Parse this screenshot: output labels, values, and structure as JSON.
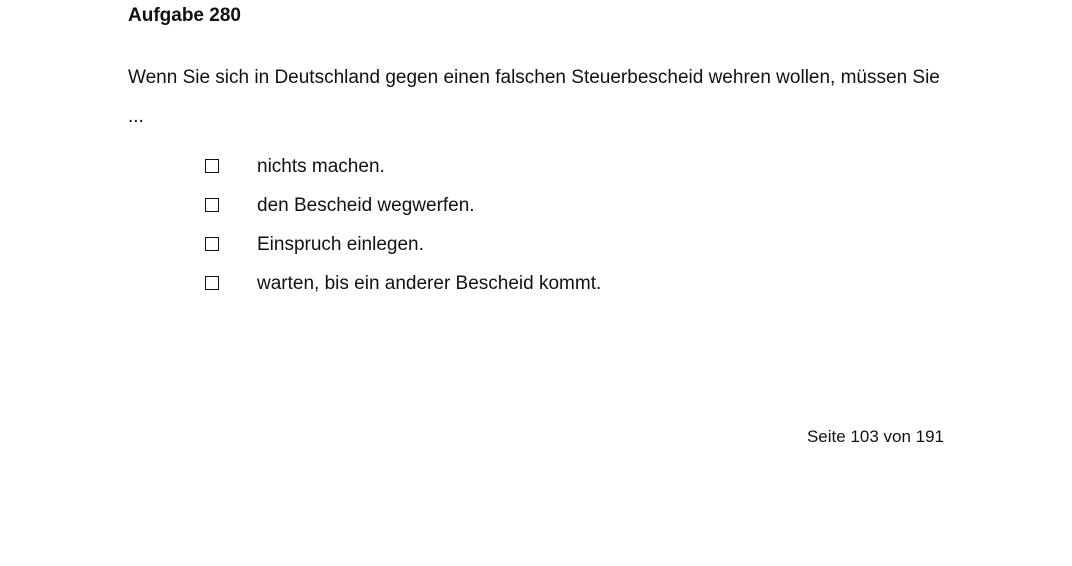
{
  "task": {
    "title": "Aufgabe 280",
    "question": "Wenn Sie sich in Deutschland gegen einen falschen Steuerbescheid wehren wollen, müssen Sie ...",
    "options": [
      "nichts machen.",
      "den Bescheid wegwerfen.",
      "Einspruch einlegen.",
      "warten, bis ein anderer Bescheid kommt."
    ]
  },
  "footer": {
    "page_label": "Seite 103 von 191"
  }
}
